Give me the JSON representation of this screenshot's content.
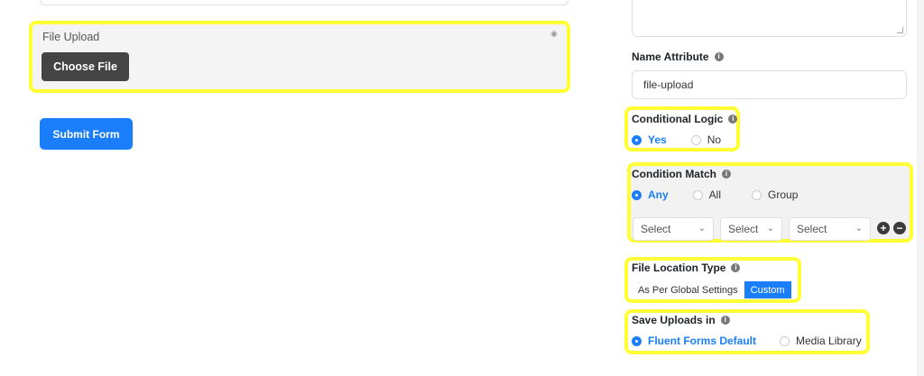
{
  "form_canvas": {
    "file_upload_label": "File Upload",
    "choose_file_label": "Choose File",
    "submit_label": "Submit Form"
  },
  "settings": {
    "name_attribute": {
      "label": "Name Attribute",
      "value": "file-upload"
    },
    "conditional_logic": {
      "label": "Conditional Logic",
      "options": [
        "Yes",
        "No"
      ],
      "selected": "Yes"
    },
    "condition_match": {
      "label": "Condition Match",
      "options": [
        "Any",
        "All",
        "Group"
      ],
      "selected": "Any",
      "selects": [
        "Select",
        "Select",
        "Select"
      ]
    },
    "file_location_type": {
      "label": "File Location Type",
      "options": [
        "As Per Global Settings",
        "Custom"
      ],
      "selected": "Custom"
    },
    "save_uploads_in": {
      "label": "Save Uploads in",
      "options": [
        "Fluent Forms Default",
        "Media Library"
      ],
      "selected": "Fluent Forms Default"
    }
  },
  "colors": {
    "accent": "#1a7efb",
    "highlight": "#ffff33",
    "dark_button": "#444444"
  },
  "icons": {
    "info": "info-icon",
    "add": "plus-circle-icon",
    "remove": "minus-circle-icon",
    "dropdown": "chevron-down-icon"
  }
}
